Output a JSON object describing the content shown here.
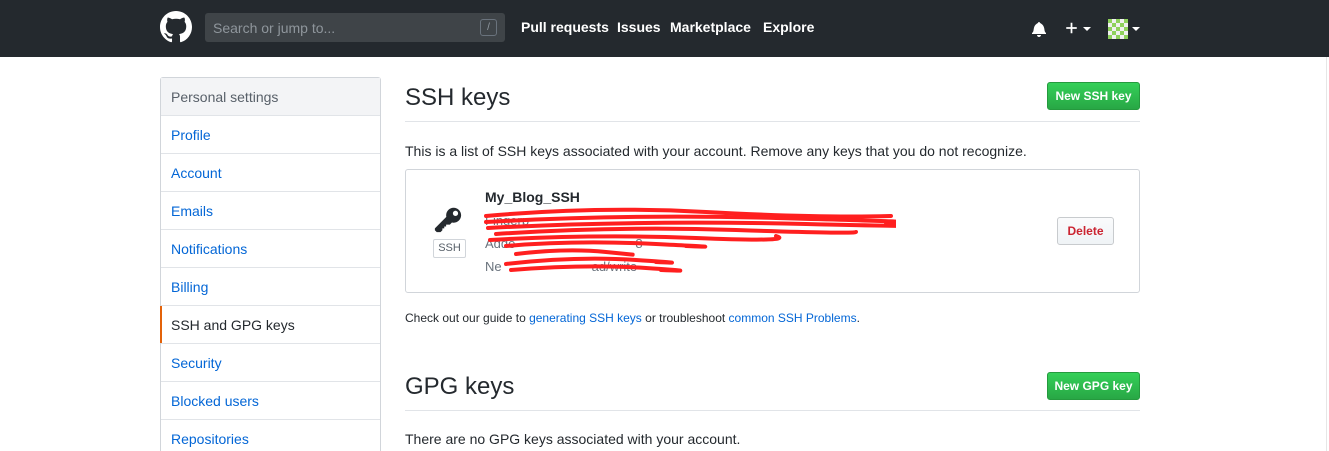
{
  "header": {
    "search_placeholder": "Search or jump to...",
    "search_shortcut": "/",
    "nav": [
      "Pull requests",
      "Issues",
      "Marketplace",
      "Explore"
    ],
    "icons": [
      "github-logo",
      "bell-icon",
      "plus-icon",
      "avatar"
    ]
  },
  "sidebar": {
    "heading": "Personal settings",
    "items": [
      {
        "label": "Profile"
      },
      {
        "label": "Account"
      },
      {
        "label": "Emails"
      },
      {
        "label": "Notifications"
      },
      {
        "label": "Billing"
      },
      {
        "label": "SSH and GPG keys",
        "selected": true
      },
      {
        "label": "Security"
      },
      {
        "label": "Blocked users"
      },
      {
        "label": "Repositories"
      }
    ]
  },
  "ssh": {
    "title": "SSH keys",
    "new_button": "New SSH key",
    "intro": "This is a list of SSH keys associated with your account. Remove any keys that you do not recognize.",
    "key": {
      "name": "My_Blog_SSH",
      "type_label": "SSH",
      "fingerprint_prefix": "Fingerp",
      "added_prefix": "Adde",
      "added_suffix": "8",
      "usage_prefix": "Ne",
      "usage_suffix": "ad/write",
      "delete_button": "Delete"
    },
    "guide": {
      "text_before": "Check out our guide to ",
      "link1": "generating SSH keys",
      "text_middle": " or troubleshoot ",
      "link2": "common SSH Problems",
      "text_after": "."
    }
  },
  "gpg": {
    "title": "GPG keys",
    "new_button": "New GPG key",
    "empty_text": "There are no GPG keys associated with your account."
  },
  "colors": {
    "header_bg": "#24292e",
    "link": "#0366d6",
    "green_button": "#28a745",
    "danger": "#cb2431",
    "selected_indicator": "#e36209",
    "redaction": "#ff1f1f"
  }
}
